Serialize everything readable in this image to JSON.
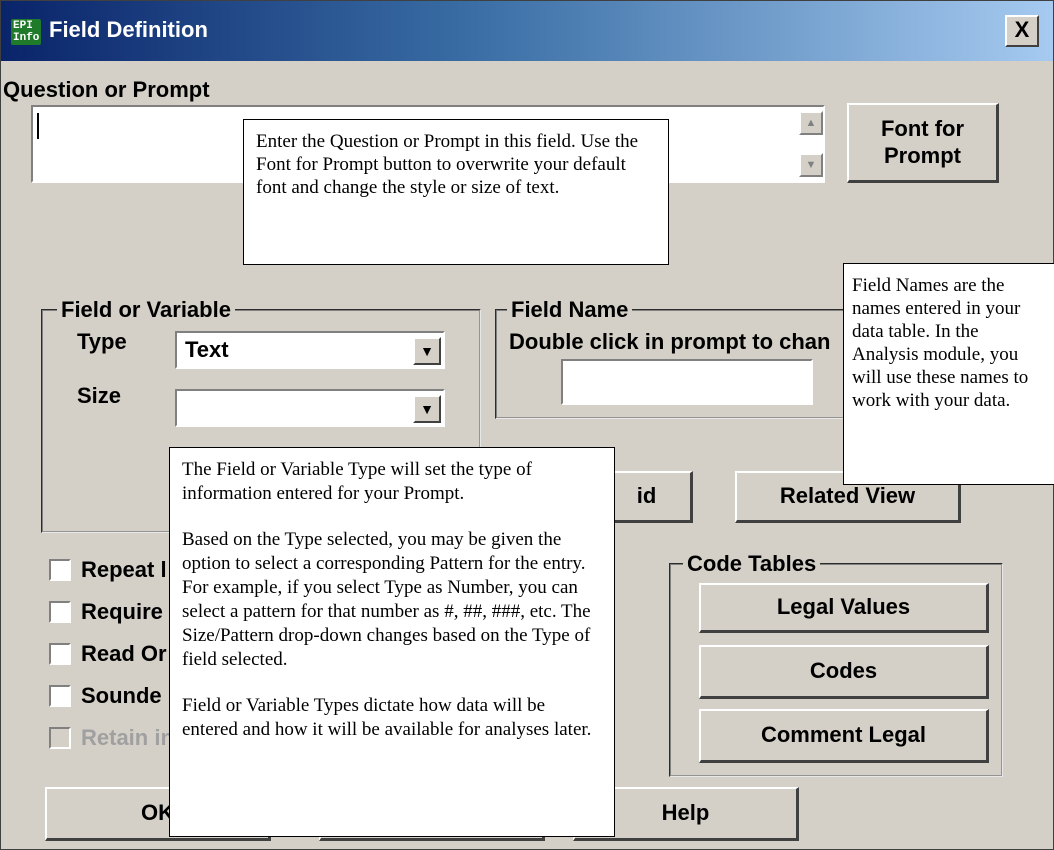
{
  "window": {
    "title": "Field Definition",
    "app_icon_text": "EPI Info",
    "close_label": "X"
  },
  "prompt": {
    "label": "Question or Prompt",
    "value": "",
    "font_button": "Font for Prompt"
  },
  "field_var": {
    "legend": "Field or Variable",
    "type_label": "Type",
    "type_value": "Text",
    "size_label": "Size",
    "size_value": ""
  },
  "field_name": {
    "legend": "Field Name",
    "hint": "Double click in prompt to chan",
    "value": ""
  },
  "buttons": {
    "grid_partial": "id",
    "related_view": "Related View",
    "ok": "OK",
    "help": "Help"
  },
  "checkboxes": [
    {
      "label": "Repeat l",
      "enabled": true
    },
    {
      "label": "Require",
      "enabled": true
    },
    {
      "label": "Read Or",
      "enabled": true
    },
    {
      "label": "Sounde",
      "enabled": true
    },
    {
      "label": "Retain in",
      "enabled": false
    }
  ],
  "code_tables": {
    "legend": "Code Tables",
    "legal_values": "Legal Values",
    "codes": "Codes",
    "comment_legal": "Comment Legal"
  },
  "callouts": {
    "prompt_note": "Enter the Question or Prompt in this field. Use the Font for Prompt button to overwrite your default font and change the style or size of text.",
    "field_name_note": "Field Names are the names entered in your data table. In the Analysis module, you will use these names to work with your data.",
    "type_note_p1": "The Field or Variable Type will set the type of information entered for your Prompt.",
    "type_note_p2": "Based on the Type selected, you may be given the option to select a corresponding Pattern for the entry. For example, if you select Type as Number, you can select a pattern for that number as #, ##, ###, etc. The Size/Pattern drop-down changes based on the Type of field selected.",
    "type_note_p3": "Field or Variable Types dictate how data will be entered and how it will be available for analyses later."
  }
}
